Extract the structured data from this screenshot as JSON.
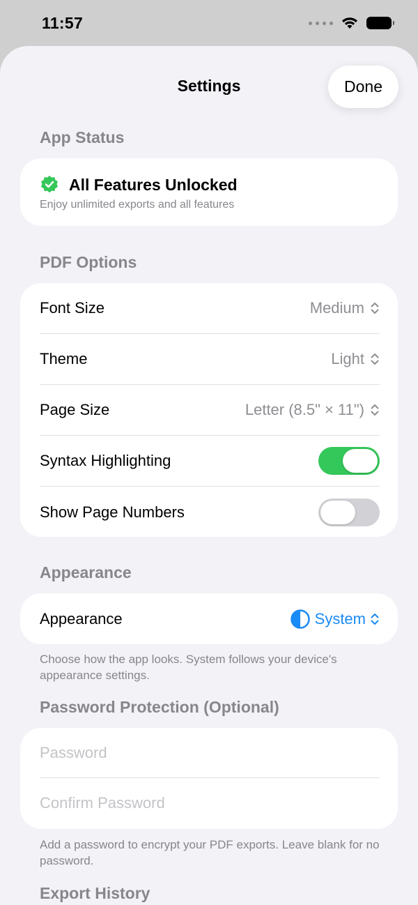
{
  "status_bar": {
    "time": "11:57"
  },
  "nav": {
    "title": "Settings",
    "done_label": "Done"
  },
  "app_status": {
    "header": "App Status",
    "title": "All Features Unlocked",
    "subtitle": "Enjoy unlimited exports and all features",
    "badge_color": "#34c759"
  },
  "pdf_options": {
    "header": "PDF Options",
    "font_size": {
      "label": "Font Size",
      "value": "Medium"
    },
    "theme": {
      "label": "Theme",
      "value": "Light"
    },
    "page_size": {
      "label": "Page Size",
      "value": "Letter (8.5\" × 11\")"
    },
    "syntax_highlighting": {
      "label": "Syntax Highlighting",
      "on": true
    },
    "show_page_numbers": {
      "label": "Show Page Numbers",
      "on": false
    }
  },
  "appearance": {
    "header": "Appearance",
    "label": "Appearance",
    "value": "System",
    "footer": "Choose how the app looks. System follows your device's appearance settings.",
    "accent": "#1a8af5"
  },
  "password": {
    "header": "Password Protection (Optional)",
    "password_placeholder": "Password",
    "confirm_placeholder": "Confirm Password",
    "footer": "Add a password to encrypt your PDF exports. Leave blank for no password."
  },
  "export_history": {
    "header": "Export History"
  }
}
